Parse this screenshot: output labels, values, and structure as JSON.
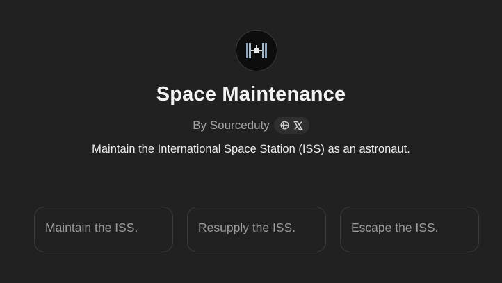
{
  "gpt": {
    "icon": "space-station-icon",
    "name": "Space Maintenance",
    "author": "By Sourceduty",
    "links": [
      "globe-icon",
      "x-logo-icon"
    ],
    "description": "Maintain the International Space Station (ISS) as an astronaut."
  },
  "starters": [
    "Maintain the ISS.",
    "Resupply the ISS.",
    "Escape the ISS."
  ],
  "colors": {
    "background": "#212121",
    "card_border": "#3b3b3b",
    "muted_text": "#9b9b9b"
  }
}
